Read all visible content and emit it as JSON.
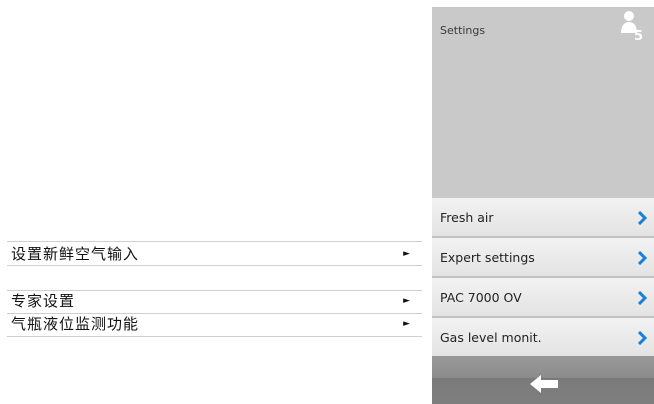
{
  "translations": [
    {
      "label": "设置新鲜空气输入",
      "arrow": "►"
    },
    {
      "label": "专家设置",
      "arrow": "►"
    },
    {
      "label": "气瓶液位监测功能",
      "arrow": "►"
    }
  ],
  "panel": {
    "title": "Settings",
    "user_level": "5",
    "menu": [
      {
        "label": "Fresh air",
        "icon": "chevron-right-icon"
      },
      {
        "label": "Expert settings",
        "icon": "chevron-right-icon"
      },
      {
        "label": "PAC 7000 OV",
        "icon": "chevron-right-icon"
      },
      {
        "label": "Gas level monit.",
        "icon": "chevron-right-icon"
      }
    ],
    "back_icon": "back-arrow-icon"
  },
  "colors": {
    "accent": "#1a7fd6",
    "panel_bg": "#c9c9c9",
    "menu_bg": "#efefef",
    "back_bar": "#8c8c8c"
  }
}
